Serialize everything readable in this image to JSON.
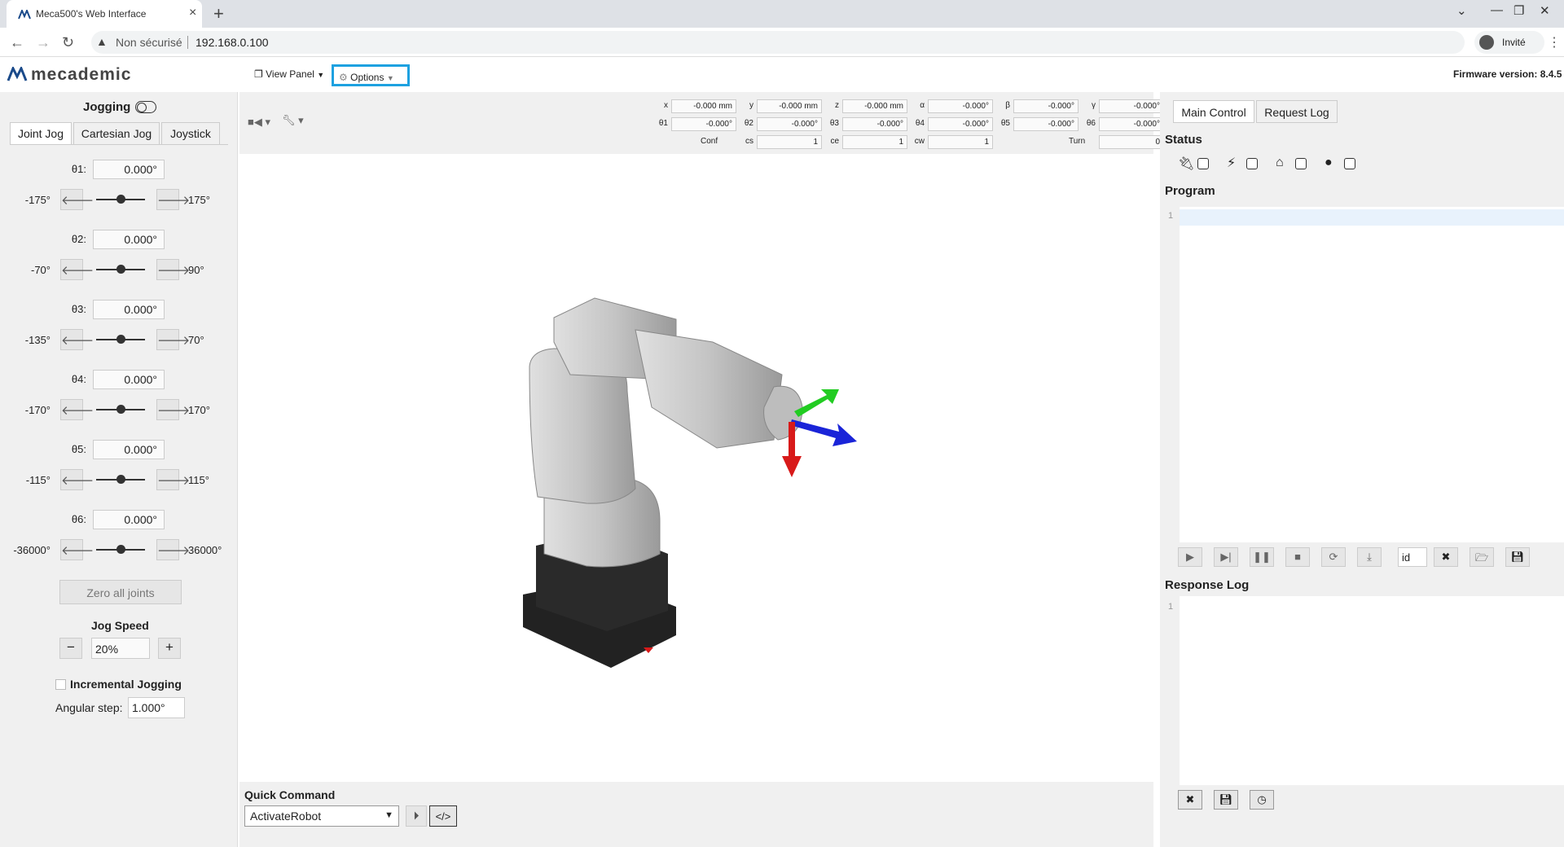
{
  "browser": {
    "tab_title": "Meca500's Web Interface",
    "new_tab": "+",
    "security": "Non sécurisé",
    "url": "192.168.0.100",
    "profile": "Invité"
  },
  "app": {
    "logo": "mecademic",
    "view_panel": "View Panel",
    "options": "Options",
    "firmware": "Firmware version: 8.4.5"
  },
  "jogging": {
    "title": "Jogging",
    "tabs": [
      "Joint Jog",
      "Cartesian Jog",
      "Joystick"
    ],
    "joints": [
      {
        "label": "θ1:",
        "value": "0.000°",
        "min": "-175°",
        "max": "175°"
      },
      {
        "label": "θ2:",
        "value": "0.000°",
        "min": "-70°",
        "max": "90°"
      },
      {
        "label": "θ3:",
        "value": "0.000°",
        "min": "-135°",
        "max": "70°"
      },
      {
        "label": "θ4:",
        "value": "0.000°",
        "min": "-170°",
        "max": "170°"
      },
      {
        "label": "θ5:",
        "value": "0.000°",
        "min": "-115°",
        "max": "115°"
      },
      {
        "label": "θ6:",
        "value": "0.000°",
        "min": "-36000°",
        "max": "36000°"
      }
    ],
    "zero_all": "Zero all joints",
    "jog_speed_label": "Jog Speed",
    "jog_speed_value": "20%",
    "minus": "−",
    "plus": "+",
    "incremental_label": "Incremental Jogging",
    "angular_step_label": "Angular step:",
    "angular_step_value": "1.000°"
  },
  "pose": {
    "row1": [
      {
        "label": "x",
        "value": "-0.000 mm"
      },
      {
        "label": "y",
        "value": "-0.000 mm"
      },
      {
        "label": "z",
        "value": "-0.000 mm"
      },
      {
        "label": "α",
        "value": "-0.000°"
      },
      {
        "label": "β",
        "value": "-0.000°"
      },
      {
        "label": "γ",
        "value": "-0.000°"
      }
    ],
    "row2": [
      {
        "label": "θ1",
        "value": "-0.000°"
      },
      {
        "label": "θ2",
        "value": "-0.000°"
      },
      {
        "label": "θ3",
        "value": "-0.000°"
      },
      {
        "label": "θ4",
        "value": "-0.000°"
      },
      {
        "label": "θ5",
        "value": "-0.000°"
      },
      {
        "label": "θ6",
        "value": "-0.000°"
      }
    ],
    "conf_label": "Conf",
    "conf": [
      {
        "label": "cs",
        "value": "1"
      },
      {
        "label": "ce",
        "value": "1"
      },
      {
        "label": "cw",
        "value": "1"
      }
    ],
    "turn_label": "Turn",
    "turn_value": "0"
  },
  "quick_command": {
    "title": "Quick Command",
    "selected": "ActivateRobot",
    "code_icon": "</>"
  },
  "right": {
    "tabs": [
      "Main Control",
      "Request Log"
    ],
    "status_title": "Status",
    "status_icons": [
      "plug-icon",
      "bolt-icon",
      "home-icon",
      "error-icon"
    ],
    "program_title": "Program",
    "program_line": "1",
    "program_id": "id",
    "response_title": "Response Log",
    "response_line": "1"
  }
}
